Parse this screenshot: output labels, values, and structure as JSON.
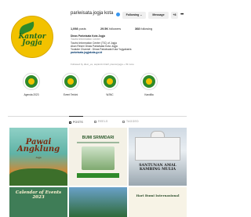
{
  "profile": {
    "username": "pariwisata.jogja kota",
    "logo_text": "Kantor Jogja",
    "follow_label": "Following ⌄",
    "message_label": "Message",
    "add_label": "+8",
    "more_label": "•••"
  },
  "stats": {
    "posts": "1,098",
    "posts_label": "posts",
    "followers": "29.5K",
    "followers_label": "followers",
    "following": "368",
    "following_label": "following"
  },
  "bio": {
    "name": "Dinas Pariwisata Kota Jogja",
    "category": "Tourist Information Center",
    "lines": [
      "Tourist Information Center (TIC) of Jogja",
      "Akun Resmi Dinas Pariwisata Kota Jogja",
      "Youtube Channel : Dinas Pariwisata Kota Yogyakarta"
    ],
    "link": "pariwisata.jogjakota.go.id",
    "followed_by": "Followed by dkun_es, asplercinrtratif, pleural.jogja + 39 more"
  },
  "highlights": [
    {
      "label": "Agenda 2023"
    },
    {
      "label": "Event Terkini"
    },
    {
      "label": "WJNC"
    },
    {
      "label": "Kandilla"
    }
  ],
  "tabs": {
    "posts": "POSTS",
    "reels": "REELS",
    "tagged": "TAGGED"
  },
  "posts": {
    "p1_title": "Pawai Angklung",
    "p1_sub": "Jogja",
    "p2_title": "BUMI SRIWIDARI",
    "p3_title": "SANTUNAN AMAL KAMBING MULIA",
    "p4_title": "Calendar of Events 2023",
    "p6_title": "Hari Bumi Internasional"
  },
  "colors": {
    "accent": "#3897f0",
    "logo_bg": "#f2c200",
    "highlight_green": "#2f8a2a"
  }
}
